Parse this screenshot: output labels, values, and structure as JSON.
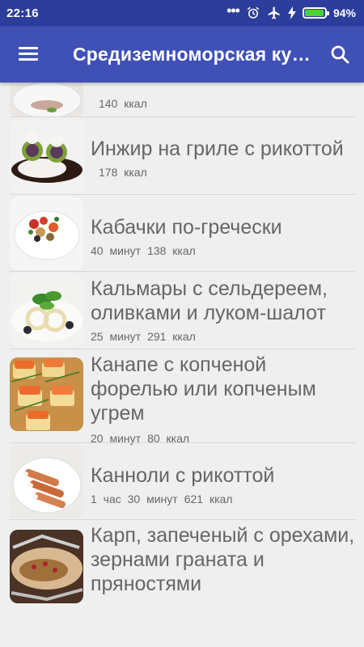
{
  "status_bar": {
    "time": "22:16",
    "dots": "•••",
    "battery_percent": "94%",
    "battery_level": 0.94
  },
  "app_bar": {
    "title": "Средиземноморская кухня",
    "menu_icon": "menu-icon",
    "search_icon": "search-icon"
  },
  "recipes": [
    {
      "title": "",
      "time": "",
      "calories": "140 ккал"
    },
    {
      "title": "Инжир на гриле с рикоттой",
      "time": "",
      "calories": "178 ккал"
    },
    {
      "title": "Кабачки по-гречески",
      "time": "40 минут",
      "calories": "138 ккал"
    },
    {
      "title": "Кальмары с сельдереем, оливками и луком-шалот",
      "time": "25 минут",
      "calories": "291 ккал"
    },
    {
      "title": "Канапе с копченой форелью или копченым угрем",
      "time": "20 минут",
      "calories": "80 ккал"
    },
    {
      "title": "Канноли с рикоттой",
      "time": "1 час 30 минут",
      "calories": "621 ккал"
    },
    {
      "title": "Карп, запеченый с орехами, зернами граната и пряностями",
      "time": "",
      "calories": ""
    }
  ]
}
